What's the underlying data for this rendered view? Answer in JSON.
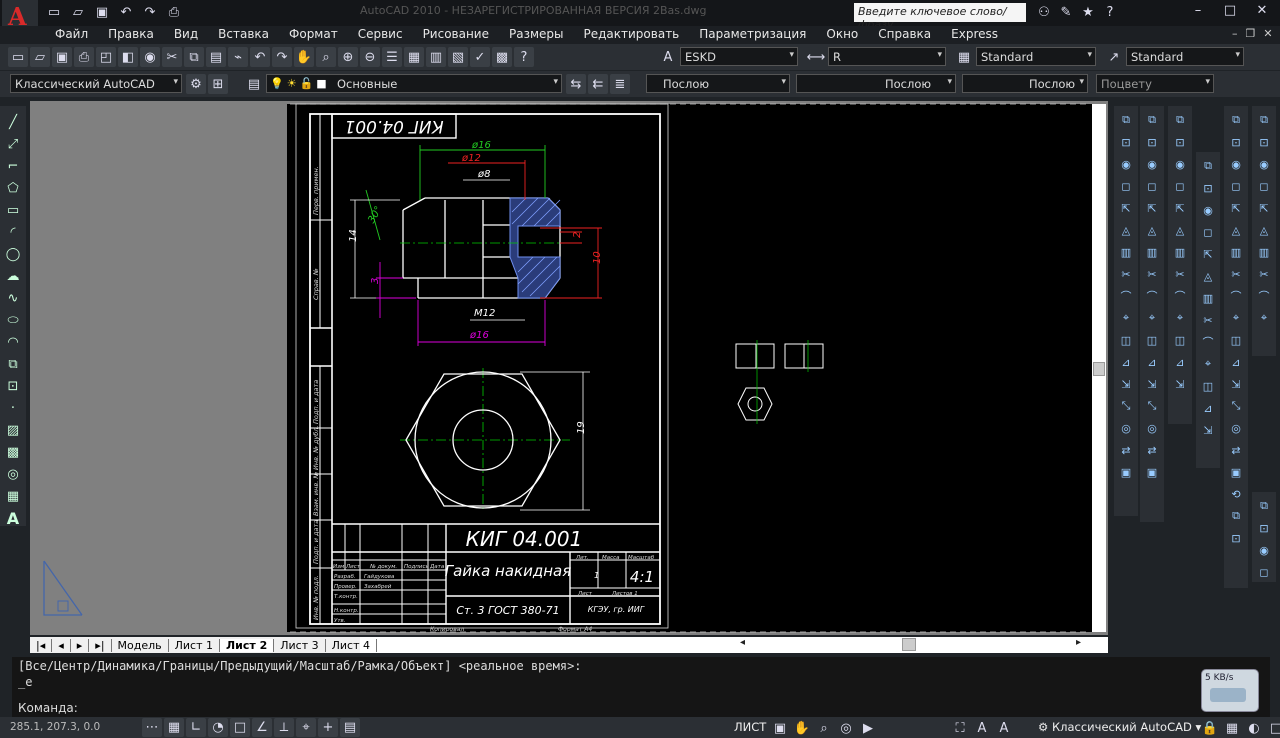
{
  "app": {
    "title": "AutoCAD 2010 - НЕЗАРЕГИСТРИРОВАННАЯ ВЕРСИЯ   2Bas.dwg",
    "search_placeholder": "Введите ключевое слово/фразу"
  },
  "menu": [
    "Файл",
    "Правка",
    "Вид",
    "Вставка",
    "Формат",
    "Сервис",
    "Рисование",
    "Размеры",
    "Редактировать",
    "Параметризация",
    "Окно",
    "Справка",
    "Express"
  ],
  "styles": {
    "text_style": "ESKD",
    "dim_style": "R",
    "table_style": "Standard",
    "mleader_style": "Standard"
  },
  "workspace": {
    "name": "Классический AutoCAD"
  },
  "layers": {
    "current": "Основные"
  },
  "properties": {
    "color": "Послою",
    "linetype": "Послою",
    "lineweight": "Послою",
    "plotstyle": "Поцвету"
  },
  "tabs": [
    {
      "label": "Модель",
      "active": false
    },
    {
      "label": "Лист 1",
      "active": false
    },
    {
      "label": "Лист 2",
      "active": true
    },
    {
      "label": "Лист 3",
      "active": false
    },
    {
      "label": "Лист 4",
      "active": false
    }
  ],
  "drawing": {
    "code": "КИГ 04.001",
    "code_rot": "КИГ 04.001",
    "part_name": "Гайка накидная",
    "material": "Ст. 3 ГОСТ 380-71",
    "scale": "4:1",
    "sheet": "1",
    "org": "КГЭУ, гр. ИИГ",
    "copied": "Копировал",
    "format": "Формат А4",
    "dims": {
      "d16_top": "ø16",
      "d12": "ø12",
      "d8": "ø8",
      "angle": "30°",
      "h14": "14",
      "h3": "3",
      "thread": "M12",
      "d16_bot": "ø16",
      "w2": "2",
      "w10": "10",
      "h19": "19"
    },
    "tb_labels": {
      "lit": "Лит.",
      "mass": "Масса",
      "scale": "Масштаб",
      "list": "Лист",
      "lists": "Листов 1",
      "izm": "Изм",
      "list2": "Лист",
      "doc": "№ докум.",
      "sign": "Подпись",
      "date": "Дата",
      "razrab": "Разраб.",
      "prov": "Провер.",
      "tkontr": "Т.контр.",
      "nkontr": "Н.контр.",
      "utv": "Утв.",
      "razrab_name": "Гайдукова",
      "prov_name": "Захабрей"
    },
    "side_labels": {
      "perv": "Перв. примен.",
      "sprav": "Справ. №",
      "podp1": "Подп. и дата",
      "invdubl": "Инв. № дубл.",
      "vzam": "Взам. инв. №",
      "podp2": "Подп. и дата",
      "invpodl": "Инв. № подл."
    }
  },
  "command": {
    "history": "[Все/Центр/Динамика/Границы/Предыдущий/Масштаб/Рамка/Объект] <реальное время>:",
    "last": "_e",
    "prompt": "Команда:"
  },
  "status": {
    "coords": "285.1, 207.3, 0.0",
    "space": "ЛИСТ"
  },
  "network": {
    "speed": "5 KB/s"
  }
}
